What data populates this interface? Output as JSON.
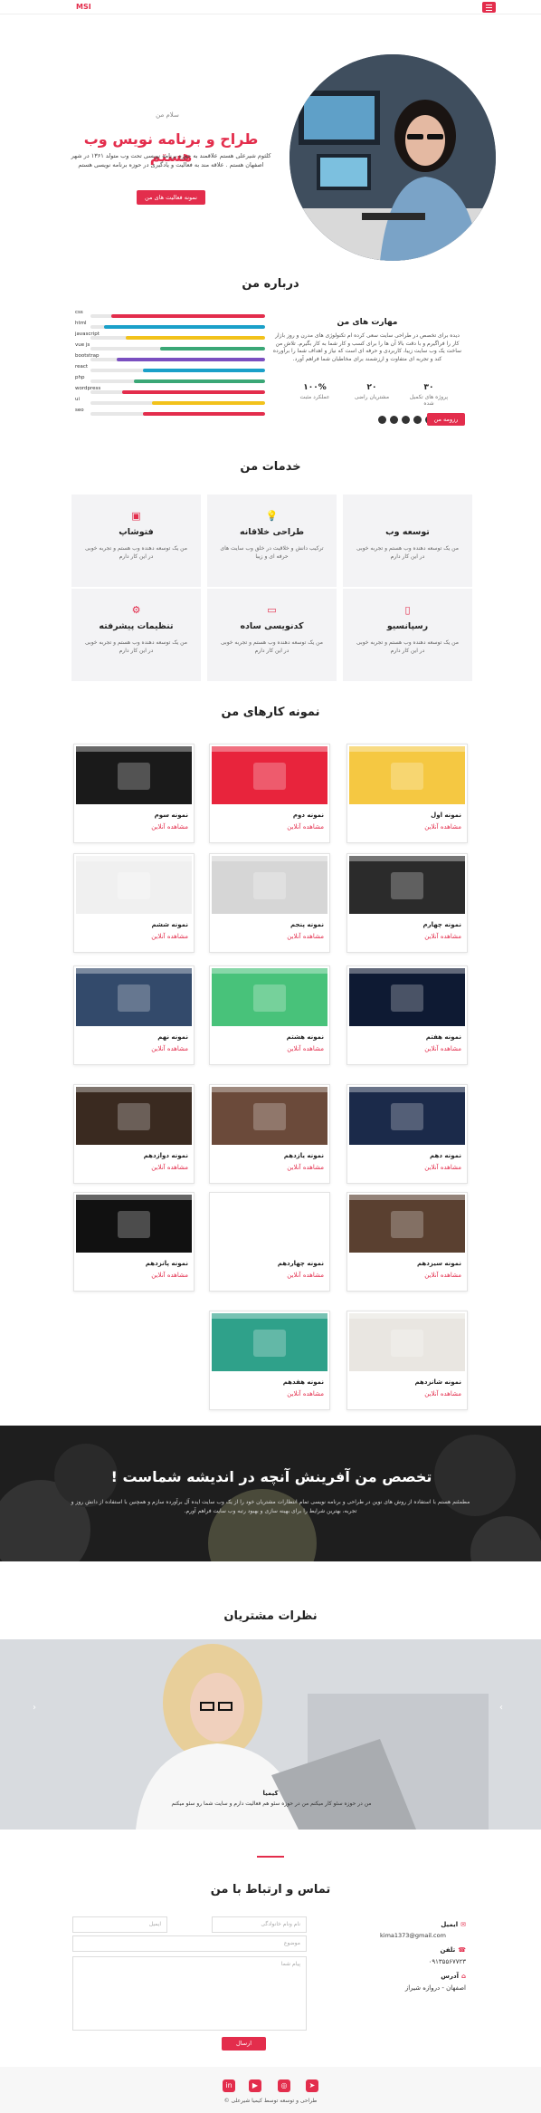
{
  "nav": {
    "logo": "MSI"
  },
  "hero": {
    "greeting": "سلام من",
    "title": "طراح و برنامه نویس وب هستم",
    "description": "کلثوم شیرعلی هستم علاقمند به حوزه برنامه نویسی تحت وب متولد ۱۳۶۱ در شهر اصفهان هستم . علاقه مند به فعالیت و یادگیری در حوزه برنامه نویسی هستم",
    "button": "نمونه فعالیت های من"
  },
  "about": {
    "section_title": "درباره من",
    "skills_title": "مهارت های من",
    "text": "دیده برای تخصص در طراحی سایت سعی کرده ام تکنولوژی های مدرن و روز بازار کار را فراگیرم و با دقت بالا آن ها را برای کسب و کار شما به کار بگیرم. تلاش من ساخت یک وب سایت زیبا، کاربردی و حرفه ای است که نیاز و اهداف شما را برآورده کند و تجربه ای متفاوت و ارزشمند برای مخاطبان شما فراهم آورد.",
    "stats": [
      {
        "value": "۳۰",
        "label": "پروژه های تکمیل شده"
      },
      {
        "value": "۲۰",
        "label": "مشتریان راضی"
      },
      {
        "value": "۱۰۰%",
        "label": "عملکرد مثبت"
      }
    ],
    "button": "رزومه من",
    "social_icons": [
      "facebook-icon",
      "twitter-icon",
      "youtube-icon",
      "instagram-icon",
      "linkedin-icon"
    ],
    "skills": [
      {
        "name": "css",
        "value": 0.88,
        "color": "#e32d4c"
      },
      {
        "name": "html",
        "value": 0.92,
        "color": "#1aa0c9"
      },
      {
        "name": "javascript",
        "value": 0.8,
        "color": "#f2c21b"
      },
      {
        "name": "vue js",
        "value": 0.6,
        "color": "#3aa776"
      },
      {
        "name": "bootstrap",
        "value": 0.85,
        "color": "#7a4fc0"
      },
      {
        "name": "react",
        "value": 0.7,
        "color": "#1aa0c9"
      },
      {
        "name": "php",
        "value": 0.75,
        "color": "#3aa776"
      },
      {
        "name": "wordpress",
        "value": 0.82,
        "color": "#e32d4c"
      },
      {
        "name": "ui",
        "value": 0.65,
        "color": "#f2c21b"
      },
      {
        "name": "seo",
        "value": 0.7,
        "color": "#e32d4c"
      }
    ]
  },
  "services": {
    "section_title": "خدمات من",
    "items": [
      {
        "icon": "code-icon",
        "title": "توسعه وب",
        "desc": "من یک توسعه دهنده وب هستم و تجربه خوبی در این کار دارم"
      },
      {
        "icon": "lightbulb-icon",
        "title": "طراحی خلاقانه",
        "desc": "ترکیب دانش و خلاقیت در خلق وب سایت های حرفه ای و زیبا"
      },
      {
        "icon": "image-icon",
        "title": "فتوشاپ",
        "desc": "من یک توسعه دهنده وب هستم و تجربه خوبی در این کار دارم"
      },
      {
        "icon": "responsive-icon",
        "title": "رسپانسیو",
        "desc": "من یک توسعه دهنده وب هستم و تجربه خوبی در این کار دارم"
      },
      {
        "icon": "laptop-icon",
        "title": "کدنویسی ساده",
        "desc": "من یک توسعه دهنده وب هستم و تجربه خوبی در این کار دارم"
      },
      {
        "icon": "gear-icon",
        "title": "تنظیمات پیشرفته",
        "desc": "من یک توسعه دهنده وب هستم و تجربه خوبی در این کار دارم"
      }
    ]
  },
  "portfolio": {
    "section_title": "نمونه کارهای من",
    "link": "مشاهده آنلاین",
    "items": [
      "نمونه اول",
      "نمونه دوم",
      "نمونه سوم",
      "نمونه چهارم",
      "نمونه پنجم",
      "نمونه ششم",
      "نمونه هفتم",
      "نمونه هشتم",
      "نمونه نهم",
      "نمونه دهم",
      "نمونه یازدهم",
      "نمونه دوازدهم",
      "نمونه سیزدهم",
      "نمونه چهاردهم",
      "نمونه پانزدهم",
      "نمونه شانزدهم",
      "نمونه هفدهم"
    ]
  },
  "banner": {
    "title": "تخصص من آفرینش آنچه در اندیشه شماست !",
    "text": "مطمئنم هستم با استفاده از روش های نوین در طراحی و برنامه نویسی تمام انتظارات مشتریان خود را از یک وب سایت ایده آل برآورده سازم و همچنین با استفاده از دانش روز و تجربه، بهترین شرایط را برای بهینه سازی و بهبود رتبه وب سایت فراهم آورم."
  },
  "testimonials": {
    "section_title": "نظرات مشتریان",
    "name": "کیمیا",
    "text": "من در حوزه سئو کار میکنم من در حوزه سئو هم فعالیت دارم و سایت شما رو سئو میکنم"
  },
  "contact": {
    "section_title": "تماس و ارتباط با من",
    "name_placeholder": "نام ونام خانوادگی",
    "email_placeholder": "ایمیل",
    "subject_placeholder": "موضوع",
    "message_placeholder": "پیام شما",
    "submit": "ارسال",
    "email_label": "ایمیل",
    "email_value": "kima1373@gmail.com",
    "phone_label": "تلفن",
    "phone_value": "۰۹۱۳۵۵۶۷۷۲۳",
    "address_label": "آدرس",
    "address_value": "اصفهان - دروازه شیراز"
  },
  "footer": {
    "copyright": "طراحی و توسعه توسط کیمیا شیرعلی ©",
    "social_icons": [
      "telegram-icon",
      "instagram-icon",
      "youtube-icon",
      "linkedin-icon"
    ]
  }
}
